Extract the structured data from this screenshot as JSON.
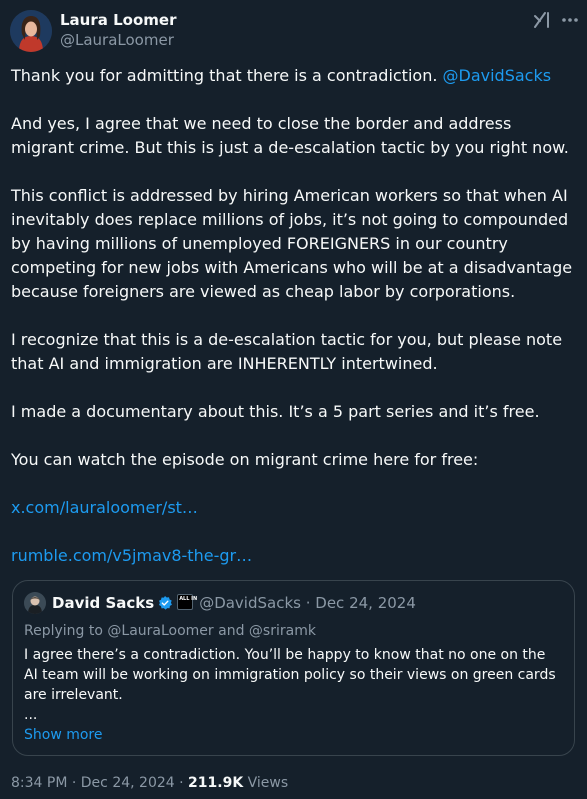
{
  "author": {
    "name": "Laura Loomer",
    "handle": "@LauraLoomer"
  },
  "post": {
    "p1_text": "Thank you for admitting that there is a contradiction. ",
    "p1_mention": "@DavidSacks",
    "p2": "And yes, I agree that we need to close the border and address migrant crime. But this is just a de-escalation tactic by you right now.",
    "p3": "This conflict is addressed by hiring American workers so that when AI inevitably does replace millions of jobs, it’s not going to compounded by having millions of unemployed FOREIGNERS in our country competing for new jobs with Americans who will be at a disadvantage because foreigners are viewed as cheap labor by corporations.",
    "p4": "I recognize that this is a de-escalation tactic for you, but please note that AI and immigration are INHERENTLY intertwined.",
    "p5": "I made a documentary about this. It’s a 5 part series and it’s free.",
    "p6": "You can watch the episode on migrant crime here for free:",
    "link1": "x.com/lauraloomer/st…",
    "link2": "rumble.com/v5jmav8-the-gr…"
  },
  "quote": {
    "name": "David Sacks",
    "handle": "@DavidSacks",
    "sep": " · ",
    "date": "Dec 24, 2024",
    "reply_prefix": "Replying to ",
    "reply_user1": "@LauraLoomer",
    "reply_and": " and ",
    "reply_user2": "@sriramk",
    "text": "I agree there’s a contradiction. You’ll be happy to know that no one on the AI team will be working on immigration policy so their views on green cards are irrelevant.",
    "ellipsis": "...",
    "show_more": "Show more",
    "badge_text": "ALL IN"
  },
  "meta": {
    "time": "8:34 PM",
    "sep": " · ",
    "date": "Dec 24, 2024",
    "sep2": " · ",
    "views_count": "211.9K",
    "views_label": " Views"
  },
  "colors": {
    "background": "#15202b",
    "link": "#1d9bf0",
    "muted": "#8b98a5",
    "border": "#38444d",
    "verified": "#1d9bf0"
  },
  "icons": [
    "grok-icon",
    "more-options-icon",
    "verified-badge-icon",
    "affiliate-badge-icon"
  ]
}
